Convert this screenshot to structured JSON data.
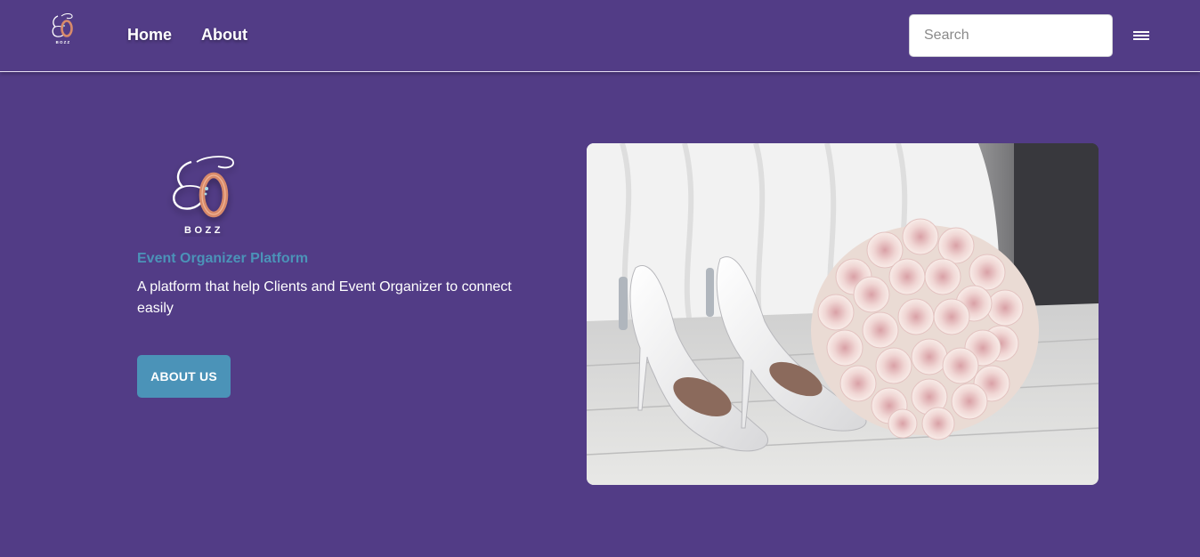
{
  "nav": {
    "logo_alt": "EO BOZZ logo",
    "links": [
      {
        "label": "Home"
      },
      {
        "label": "About"
      }
    ],
    "search": {
      "placeholder": "Search",
      "value": ""
    },
    "menu_icon": "hamburger-menu-icon"
  },
  "hero": {
    "logo_text": "BOZZ",
    "tagline": "Event Organizer Platform",
    "description": "A platform that help Clients and Event Organizer to connect easily",
    "button_label": "ABOUT US",
    "image_alt": "White wedding heels with a bouquet of pink roses"
  },
  "colors": {
    "background": "#523c86",
    "accent": "#4b93b8",
    "text": "#ffffff",
    "logo_ring": "#d88a6a"
  }
}
